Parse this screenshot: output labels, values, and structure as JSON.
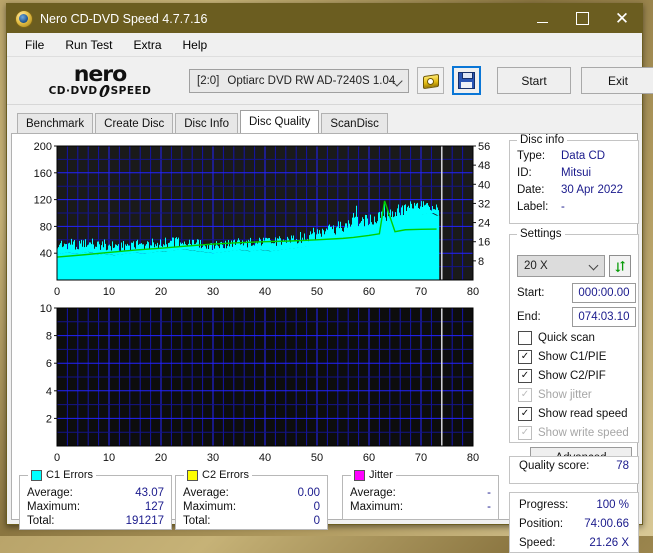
{
  "window": {
    "title": "Nero CD-DVD Speed 4.7.7.16",
    "minimize": "–",
    "maximize": "",
    "close": "✕"
  },
  "menu": {
    "items": [
      "File",
      "Run Test",
      "Extra",
      "Help"
    ]
  },
  "toolbar": {
    "logo_line1": "nero",
    "logo_left": "CD·DVD",
    "logo_right": "SPEED",
    "drive_id": "[2:0]",
    "drive_name": "Optiarc DVD RW AD-7240S 1.04",
    "disc_icon": "disc-icon",
    "save_icon": "floppy-save-icon",
    "start_label": "Start",
    "exit_label": "Exit"
  },
  "tabs": [
    {
      "label": "Benchmark",
      "active": false
    },
    {
      "label": "Create Disc",
      "active": false
    },
    {
      "label": "Disc Info",
      "active": false
    },
    {
      "label": "Disc Quality",
      "active": true
    },
    {
      "label": "ScanDisc",
      "active": false
    }
  ],
  "disc_info": {
    "title": "Disc info",
    "rows": [
      {
        "label": "Type:",
        "value": "Data CD"
      },
      {
        "label": "ID:",
        "value": "Mitsui"
      },
      {
        "label": "Date:",
        "value": "30 Apr 2022"
      },
      {
        "label": "Label:",
        "value": "-"
      }
    ]
  },
  "settings": {
    "title": "Settings",
    "speed": "20 X",
    "refresh_icon": "refresh-icon",
    "start_label": "Start:",
    "start_value": "000:00.00",
    "end_label": "End:",
    "end_value": "074:03.10",
    "checkboxes": [
      {
        "label": "Quick scan",
        "checked": false,
        "disabled": false
      },
      {
        "label": "Show C1/PIE",
        "checked": true,
        "disabled": false
      },
      {
        "label": "Show C2/PIF",
        "checked": true,
        "disabled": false
      },
      {
        "label": "Show jitter",
        "checked": true,
        "disabled": true
      },
      {
        "label": "Show read speed",
        "checked": true,
        "disabled": false
      },
      {
        "label": "Show write speed",
        "checked": true,
        "disabled": true
      }
    ],
    "advanced_label": "Advanced"
  },
  "quality": {
    "label": "Quality score:",
    "value": "78"
  },
  "status": {
    "rows": [
      {
        "label": "Progress:",
        "value": "100 %"
      },
      {
        "label": "Position:",
        "value": "74:00.66"
      },
      {
        "label": "Speed:",
        "value": "21.26 X"
      }
    ]
  },
  "stats": {
    "c1": {
      "title": "C1 Errors",
      "color": "#00ffff",
      "rows": [
        {
          "label": "Average:",
          "value": "43.07"
        },
        {
          "label": "Maximum:",
          "value": "127"
        },
        {
          "label": "Total:",
          "value": "191217"
        }
      ]
    },
    "c2": {
      "title": "C2 Errors",
      "color": "#ffff00",
      "rows": [
        {
          "label": "Average:",
          "value": "0.00"
        },
        {
          "label": "Maximum:",
          "value": "0"
        },
        {
          "label": "Total:",
          "value": "0"
        }
      ]
    },
    "jitter": {
      "title": "Jitter",
      "color": "#ff00ff",
      "rows": [
        {
          "label": "Average:",
          "value": "-"
        },
        {
          "label": "Maximum:",
          "value": "-"
        }
      ]
    }
  },
  "chart_data": [
    {
      "type": "area",
      "name": "c1-errors-chart",
      "title": "",
      "xlabel": "",
      "ylabel": "",
      "xlim": [
        0,
        80
      ],
      "ylim": [
        0,
        200
      ],
      "xticks": [
        0,
        10,
        20,
        30,
        40,
        50,
        60,
        70,
        80
      ],
      "yticks": [
        40,
        80,
        120,
        160,
        200
      ],
      "y2lim": [
        0,
        56
      ],
      "y2ticks": [
        8,
        16,
        24,
        32,
        40,
        48,
        56
      ],
      "grid": true,
      "bg": "#1a1a1a",
      "gridcolor": "#0000d0",
      "cursor_x": 74,
      "data_end_x": 73.5,
      "series": [
        {
          "name": "C1 Errors",
          "color": "#00ffff",
          "style": "filled-spikes",
          "x": [
            0,
            1,
            2,
            3,
            4,
            5,
            6,
            7,
            8,
            9,
            10,
            11,
            12,
            13,
            14,
            15,
            16,
            17,
            18,
            19,
            20,
            21,
            22,
            23,
            24,
            25,
            26,
            27,
            28,
            29,
            30,
            31,
            32,
            33,
            34,
            35,
            36,
            37,
            38,
            39,
            40,
            41,
            42,
            43,
            44,
            45,
            46,
            47,
            48,
            49,
            50,
            51,
            52,
            53,
            54,
            55,
            56,
            57,
            58,
            59,
            60,
            61,
            62,
            63,
            64,
            65,
            66,
            67,
            68,
            69,
            70,
            71,
            72,
            73
          ],
          "baseline": [
            38,
            40,
            41,
            40,
            39,
            41,
            42,
            40,
            38,
            39,
            38,
            37,
            38,
            39,
            40,
            41,
            40,
            39,
            41,
            42,
            43,
            42,
            44,
            45,
            46,
            45,
            44,
            43,
            42,
            41,
            40,
            41,
            42,
            43,
            44,
            45,
            44,
            43,
            44,
            45,
            44,
            43,
            44,
            45,
            46,
            47,
            48,
            49,
            50,
            52,
            54,
            56,
            58,
            60,
            62,
            64,
            66,
            68,
            70,
            72,
            74,
            76,
            78,
            80,
            85,
            88,
            90,
            92,
            94,
            96,
            98,
            99,
            100,
            96
          ],
          "peaks": [
            62,
            64,
            60,
            66,
            58,
            63,
            61,
            65,
            59,
            62,
            58,
            60,
            57,
            61,
            59,
            63,
            58,
            60,
            62,
            61,
            63,
            65,
            64,
            66,
            63,
            62,
            60,
            61,
            59,
            58,
            57,
            59,
            60,
            62,
            61,
            63,
            62,
            64,
            63,
            65,
            64,
            63,
            65,
            66,
            68,
            70,
            72,
            74,
            76,
            78,
            80,
            82,
            84,
            86,
            88,
            90,
            92,
            128,
            96,
            98,
            100,
            102,
            127,
            110,
            108,
            112,
            114,
            116,
            118,
            120,
            118,
            116,
            114,
            112
          ]
        },
        {
          "name": "Read speed",
          "color": "#00d000",
          "style": "line",
          "axis": "right",
          "x": [
            0,
            5,
            10,
            15,
            20,
            25,
            30,
            35,
            40,
            45,
            50,
            55,
            57,
            60,
            62,
            63,
            65,
            67,
            70,
            73
          ],
          "y": [
            9.6,
            10.5,
            11.5,
            12.5,
            13.3,
            14.2,
            15.0,
            15.6,
            16.0,
            16.3,
            16.8,
            17.4,
            17.8,
            18.6,
            19.3,
            33.0,
            20.2,
            21.0,
            21.2,
            21.3
          ]
        }
      ]
    },
    {
      "type": "area",
      "name": "c2-errors-chart",
      "title": "",
      "xlabel": "",
      "ylabel": "",
      "xlim": [
        0,
        80
      ],
      "ylim": [
        0,
        10
      ],
      "xticks": [
        0,
        10,
        20,
        30,
        40,
        50,
        60,
        70,
        80
      ],
      "yticks": [
        2,
        4,
        6,
        8,
        10
      ],
      "grid": true,
      "bg": "#0d0d0d",
      "gridcolor": "#0000d0",
      "cursor_x": 74,
      "series": [
        {
          "name": "C2 Errors",
          "color": "#ffff00",
          "style": "filled-spikes",
          "x": [],
          "y": []
        }
      ]
    }
  ]
}
